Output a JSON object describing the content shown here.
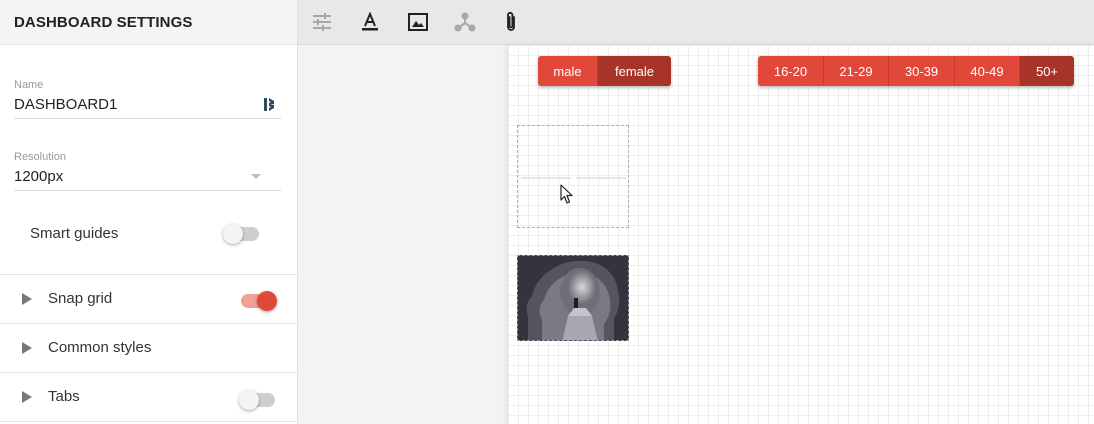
{
  "sidebar": {
    "title": "DASHBOARD SETTINGS",
    "name_field": {
      "label": "Name",
      "value": "DASHBOARD1"
    },
    "resolution_field": {
      "label": "Resolution",
      "value": "1200px"
    },
    "smart_guides": {
      "label": "Smart guides",
      "enabled": false
    },
    "sections": [
      {
        "label": "Snap grid",
        "toggle": true
      },
      {
        "label": "Common styles"
      },
      {
        "label": "Tabs",
        "toggle": false
      }
    ]
  },
  "toolbar": {
    "icons": [
      "sliders-icon",
      "text-format-icon",
      "image-icon",
      "graph-icon",
      "attachment-icon"
    ]
  },
  "canvas": {
    "gender_filter": {
      "options": [
        "male",
        "female"
      ],
      "selected": "female"
    },
    "age_filter": {
      "options": [
        "16-20",
        "21-29",
        "30-39",
        "40-49",
        "50+"
      ],
      "selected": "50+"
    }
  },
  "colors": {
    "accent": "#e2483a",
    "accent_active": "#a83328",
    "toggle_on_track": "#f1a197"
  }
}
